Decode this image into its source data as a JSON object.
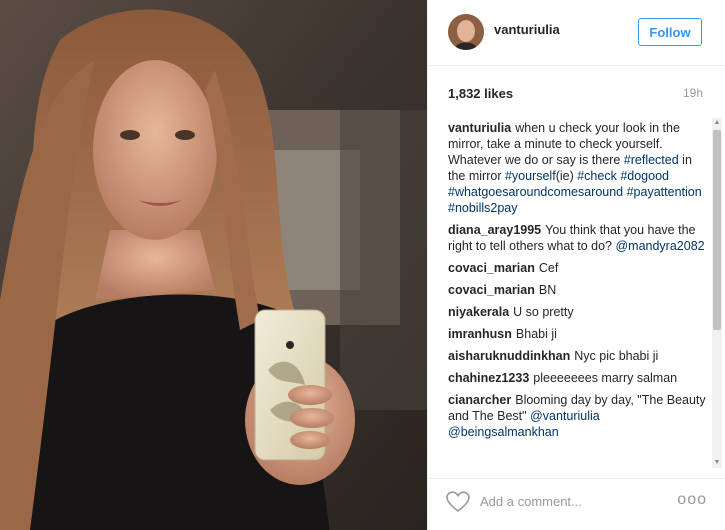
{
  "photo": {
    "alt_icon": "selfie-photo"
  },
  "header": {
    "username": "vanturiulia",
    "follow_label": "Follow"
  },
  "meta": {
    "likes": "1,832 likes",
    "time": "19h"
  },
  "comments": [
    {
      "author": "vanturiulia",
      "parts": [
        {
          "t": "when u check your look in the mirror, take a minute to check yourself. Whatever we do or say is there "
        },
        {
          "t": "#reflected",
          "tag": true
        },
        {
          "t": " in the mirror "
        },
        {
          "t": "#yourself",
          "tag": true
        },
        {
          "t": "(ie) "
        },
        {
          "t": "#check",
          "tag": true
        },
        {
          "t": " "
        },
        {
          "t": "#dogood",
          "tag": true
        },
        {
          "t": " "
        },
        {
          "t": "#whatgoesaroundcomesaround",
          "tag": true
        },
        {
          "t": " "
        },
        {
          "t": "#payattention",
          "tag": true
        },
        {
          "t": " "
        },
        {
          "t": "#nobills2pay",
          "tag": true
        }
      ]
    },
    {
      "author": "diana_aray1995",
      "parts": [
        {
          "t": "You think that you have the right to tell others what to do? "
        },
        {
          "t": "@mandyra2082",
          "tag": true
        }
      ]
    },
    {
      "author": "covaci_marian",
      "parts": [
        {
          "t": "Cef"
        }
      ]
    },
    {
      "author": "covaci_marian",
      "parts": [
        {
          "t": "BN"
        }
      ]
    },
    {
      "author": "niyakerala",
      "parts": [
        {
          "t": "U so pretty"
        }
      ]
    },
    {
      "author": "imranhusn",
      "parts": [
        {
          "t": "Bhabi ji"
        }
      ]
    },
    {
      "author": "aisharuknuddinkhan",
      "parts": [
        {
          "t": "Nyc pic bhabi ji"
        }
      ]
    },
    {
      "author": "chahinez1233",
      "parts": [
        {
          "t": "pleeeeeees marry salman"
        }
      ]
    },
    {
      "author": "cianarcher",
      "parts": [
        {
          "t": "Blooming day by day, \"The Beauty and The Best\" "
        },
        {
          "t": "@vanturiulia",
          "tag": true
        },
        {
          "t": " "
        },
        {
          "t": "@beingsalmankhan",
          "tag": true
        }
      ]
    }
  ],
  "footer": {
    "placeholder": "Add a comment...",
    "more": "ooo"
  },
  "colors": {
    "accent": "#3897f0",
    "tag": "#003569",
    "muted": "#999999"
  }
}
